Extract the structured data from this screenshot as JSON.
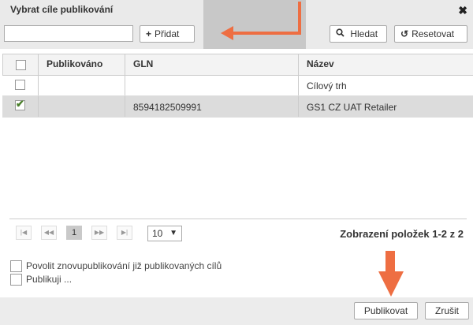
{
  "dialog": {
    "title": "Vybrat cíle publikování"
  },
  "toolbar": {
    "search_value": "",
    "add_label": "Přidat",
    "add_icon": "plus-icon",
    "search_label": "Hledat",
    "search_icon": "magnifier-icon",
    "reset_label": "Resetovat",
    "reset_icon": "undo-icon"
  },
  "table": {
    "headers": [
      "Publikováno",
      "GLN",
      "Název"
    ],
    "rows": [
      {
        "checked": false,
        "published": "",
        "gln": "",
        "name": "Cílový trh"
      },
      {
        "checked": true,
        "published": "",
        "gln": "8594182509991",
        "name": "GS1 CZ UAT Retailer"
      }
    ]
  },
  "pager": {
    "first_symbol": "|◀",
    "prev_symbol": "◀◀",
    "current_page": "1",
    "next_symbol": "▶▶",
    "last_symbol": "▶|",
    "page_size": "10",
    "info": "Zobrazení položek 1-2 z 2"
  },
  "options": {
    "republish_label": "Povolit znovupublikování již publikovaných cílů",
    "publishing_label": "Publikuji ..."
  },
  "footer": {
    "publish_label": "Publikovat",
    "cancel_label": "Zrušit"
  },
  "colors": {
    "annotation_arrow": "#ee6e42",
    "selected_row": "#dcdcdc",
    "check": "#4a7f2b"
  }
}
